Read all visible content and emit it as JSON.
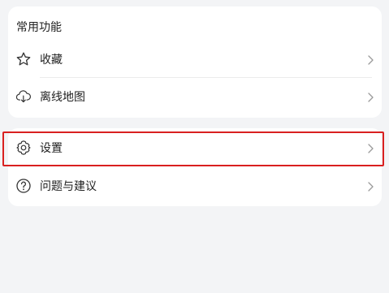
{
  "common": {
    "title": "常用功能",
    "items": [
      {
        "label": "收藏",
        "icon": "star-icon"
      },
      {
        "label": "离线地图",
        "icon": "cloud-download-icon"
      }
    ]
  },
  "settings": {
    "items": [
      {
        "label": "设置",
        "icon": "gear-icon",
        "highlighted": true
      },
      {
        "label": "问题与建议",
        "icon": "question-circle-icon"
      }
    ]
  },
  "colors": {
    "background": "#f3f4f6",
    "card": "#ffffff",
    "highlight_border": "#d92020",
    "chevron": "#9a9a9a"
  }
}
